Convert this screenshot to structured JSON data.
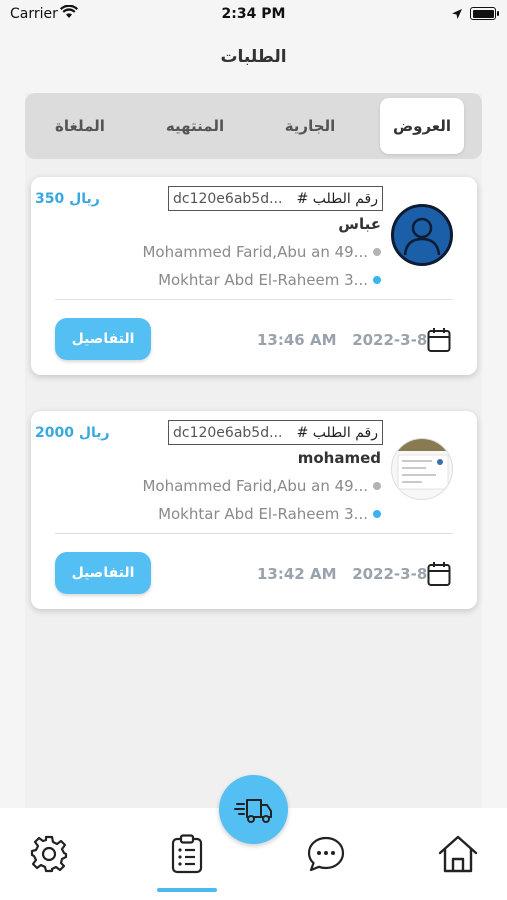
{
  "status_bar": {
    "carrier": "Carrier",
    "time": "2:34 PM"
  },
  "header": {
    "title": "الطلبات"
  },
  "tabs": [
    {
      "label": "العروض",
      "active": true
    },
    {
      "label": "الجارية",
      "active": false
    },
    {
      "label": "المنتهيه",
      "active": false
    },
    {
      "label": "الملغاة",
      "active": false
    }
  ],
  "orders": [
    {
      "order_id_label": "# رقم الطلب",
      "order_id": "dc120e6ab5d...",
      "price": "350 ريال",
      "customer_name": "عباس",
      "pickup_address": "Mohammed Farid,Abu an 49...",
      "dropoff_address": "Mokhtar Abd El-Raheem 3...",
      "date": "2022-3-8",
      "time": "13:46 AM",
      "details_label": "التفاصيل",
      "avatar": "default-user-avatar"
    },
    {
      "order_id_label": "# رقم الطلب",
      "order_id": "dc120e6ab5d...",
      "price": "2000 ريال",
      "customer_name": "mohamed",
      "pickup_address": "Mohammed Farid,Abu an 49...",
      "dropoff_address": "Mokhtar Abd El-Raheem 3...",
      "date": "2022-3-8",
      "time": "13:42 AM",
      "details_label": "التفاصيل",
      "avatar": "photo-avatar"
    }
  ],
  "bottom_nav": {
    "items": [
      "settings-icon",
      "orders-clipboard-icon",
      "chat-icon",
      "home-icon"
    ],
    "active": "orders-clipboard-icon",
    "fab_icon": "delivery-truck-icon"
  },
  "colors": {
    "accent": "#53bff2",
    "price": "#3aa8e0",
    "muted": "#9aa3ad"
  }
}
